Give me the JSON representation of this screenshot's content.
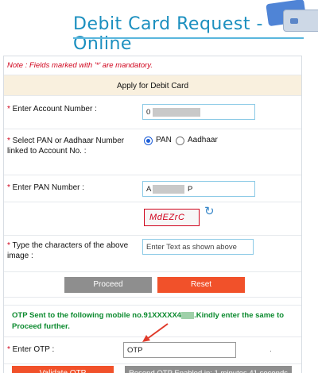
{
  "banner": {
    "title": "Debit Card Request - Online"
  },
  "note": "Note : Fields marked with '*' are mandatory.",
  "form_header": "Apply for Debit Card",
  "account": {
    "label": "Enter Account Number :",
    "value": "0"
  },
  "id_select": {
    "label": "Select PAN or Aadhaar Number linked to Account No. :",
    "options": [
      "PAN",
      "Aadhaar"
    ],
    "selected": "PAN"
  },
  "pan": {
    "label": "Enter PAN Number :",
    "value_prefix": "A",
    "value_suffix": "P"
  },
  "captcha": {
    "text": "MdEZrC",
    "refresh_icon": "refresh-icon"
  },
  "captcha_input": {
    "label": "Type the characters of the above image :",
    "placeholder": "Enter Text as shown above"
  },
  "buttons": {
    "proceed": "Proceed",
    "reset": "Reset"
  },
  "otp_message": {
    "before": "OTP Sent to the following mobile no.91XXXXX4",
    "after": ".Kindly enter the same to Proceed further."
  },
  "otp": {
    "label": "Enter OTP :",
    "placeholder": "OTP"
  },
  "otp_buttons": {
    "validate": "Validate OTP",
    "resend": "Resend OTP Enabled in: 1 minutes 41 seconds"
  },
  "colors": {
    "accent_red": "#f1512a",
    "link_blue": "#1b8fbf",
    "success_green": "#0b8a2e",
    "note_red": "#d0021b"
  }
}
